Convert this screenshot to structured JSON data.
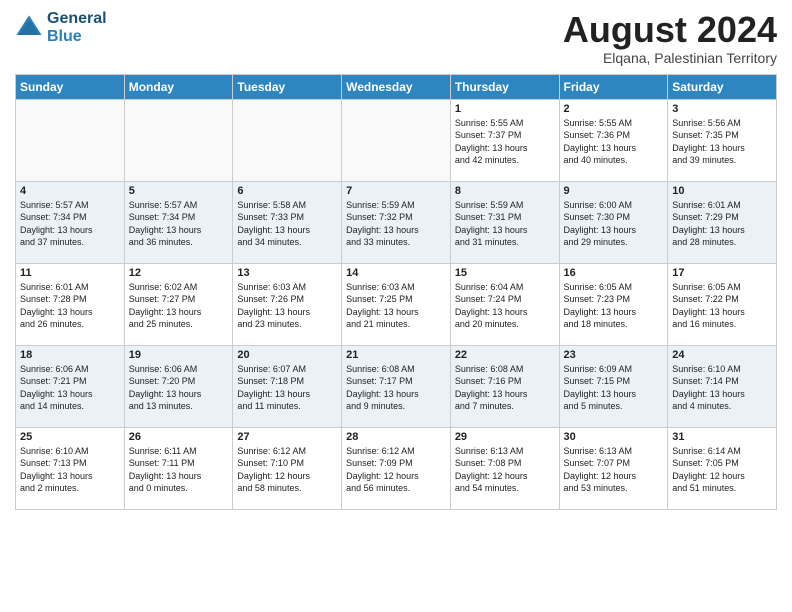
{
  "header": {
    "logo_line1": "General",
    "logo_line2": "Blue",
    "month_year": "August 2024",
    "location": "Elqana, Palestinian Territory"
  },
  "days_of_week": [
    "Sunday",
    "Monday",
    "Tuesday",
    "Wednesday",
    "Thursday",
    "Friday",
    "Saturday"
  ],
  "weeks": [
    [
      {
        "day": "",
        "info": ""
      },
      {
        "day": "",
        "info": ""
      },
      {
        "day": "",
        "info": ""
      },
      {
        "day": "",
        "info": ""
      },
      {
        "day": "1",
        "info": "Sunrise: 5:55 AM\nSunset: 7:37 PM\nDaylight: 13 hours\nand 42 minutes."
      },
      {
        "day": "2",
        "info": "Sunrise: 5:55 AM\nSunset: 7:36 PM\nDaylight: 13 hours\nand 40 minutes."
      },
      {
        "day": "3",
        "info": "Sunrise: 5:56 AM\nSunset: 7:35 PM\nDaylight: 13 hours\nand 39 minutes."
      }
    ],
    [
      {
        "day": "4",
        "info": "Sunrise: 5:57 AM\nSunset: 7:34 PM\nDaylight: 13 hours\nand 37 minutes."
      },
      {
        "day": "5",
        "info": "Sunrise: 5:57 AM\nSunset: 7:34 PM\nDaylight: 13 hours\nand 36 minutes."
      },
      {
        "day": "6",
        "info": "Sunrise: 5:58 AM\nSunset: 7:33 PM\nDaylight: 13 hours\nand 34 minutes."
      },
      {
        "day": "7",
        "info": "Sunrise: 5:59 AM\nSunset: 7:32 PM\nDaylight: 13 hours\nand 33 minutes."
      },
      {
        "day": "8",
        "info": "Sunrise: 5:59 AM\nSunset: 7:31 PM\nDaylight: 13 hours\nand 31 minutes."
      },
      {
        "day": "9",
        "info": "Sunrise: 6:00 AM\nSunset: 7:30 PM\nDaylight: 13 hours\nand 29 minutes."
      },
      {
        "day": "10",
        "info": "Sunrise: 6:01 AM\nSunset: 7:29 PM\nDaylight: 13 hours\nand 28 minutes."
      }
    ],
    [
      {
        "day": "11",
        "info": "Sunrise: 6:01 AM\nSunset: 7:28 PM\nDaylight: 13 hours\nand 26 minutes."
      },
      {
        "day": "12",
        "info": "Sunrise: 6:02 AM\nSunset: 7:27 PM\nDaylight: 13 hours\nand 25 minutes."
      },
      {
        "day": "13",
        "info": "Sunrise: 6:03 AM\nSunset: 7:26 PM\nDaylight: 13 hours\nand 23 minutes."
      },
      {
        "day": "14",
        "info": "Sunrise: 6:03 AM\nSunset: 7:25 PM\nDaylight: 13 hours\nand 21 minutes."
      },
      {
        "day": "15",
        "info": "Sunrise: 6:04 AM\nSunset: 7:24 PM\nDaylight: 13 hours\nand 20 minutes."
      },
      {
        "day": "16",
        "info": "Sunrise: 6:05 AM\nSunset: 7:23 PM\nDaylight: 13 hours\nand 18 minutes."
      },
      {
        "day": "17",
        "info": "Sunrise: 6:05 AM\nSunset: 7:22 PM\nDaylight: 13 hours\nand 16 minutes."
      }
    ],
    [
      {
        "day": "18",
        "info": "Sunrise: 6:06 AM\nSunset: 7:21 PM\nDaylight: 13 hours\nand 14 minutes."
      },
      {
        "day": "19",
        "info": "Sunrise: 6:06 AM\nSunset: 7:20 PM\nDaylight: 13 hours\nand 13 minutes."
      },
      {
        "day": "20",
        "info": "Sunrise: 6:07 AM\nSunset: 7:18 PM\nDaylight: 13 hours\nand 11 minutes."
      },
      {
        "day": "21",
        "info": "Sunrise: 6:08 AM\nSunset: 7:17 PM\nDaylight: 13 hours\nand 9 minutes."
      },
      {
        "day": "22",
        "info": "Sunrise: 6:08 AM\nSunset: 7:16 PM\nDaylight: 13 hours\nand 7 minutes."
      },
      {
        "day": "23",
        "info": "Sunrise: 6:09 AM\nSunset: 7:15 PM\nDaylight: 13 hours\nand 5 minutes."
      },
      {
        "day": "24",
        "info": "Sunrise: 6:10 AM\nSunset: 7:14 PM\nDaylight: 13 hours\nand 4 minutes."
      }
    ],
    [
      {
        "day": "25",
        "info": "Sunrise: 6:10 AM\nSunset: 7:13 PM\nDaylight: 13 hours\nand 2 minutes."
      },
      {
        "day": "26",
        "info": "Sunrise: 6:11 AM\nSunset: 7:11 PM\nDaylight: 13 hours\nand 0 minutes."
      },
      {
        "day": "27",
        "info": "Sunrise: 6:12 AM\nSunset: 7:10 PM\nDaylight: 12 hours\nand 58 minutes."
      },
      {
        "day": "28",
        "info": "Sunrise: 6:12 AM\nSunset: 7:09 PM\nDaylight: 12 hours\nand 56 minutes."
      },
      {
        "day": "29",
        "info": "Sunrise: 6:13 AM\nSunset: 7:08 PM\nDaylight: 12 hours\nand 54 minutes."
      },
      {
        "day": "30",
        "info": "Sunrise: 6:13 AM\nSunset: 7:07 PM\nDaylight: 12 hours\nand 53 minutes."
      },
      {
        "day": "31",
        "info": "Sunrise: 6:14 AM\nSunset: 7:05 PM\nDaylight: 12 hours\nand 51 minutes."
      }
    ]
  ]
}
